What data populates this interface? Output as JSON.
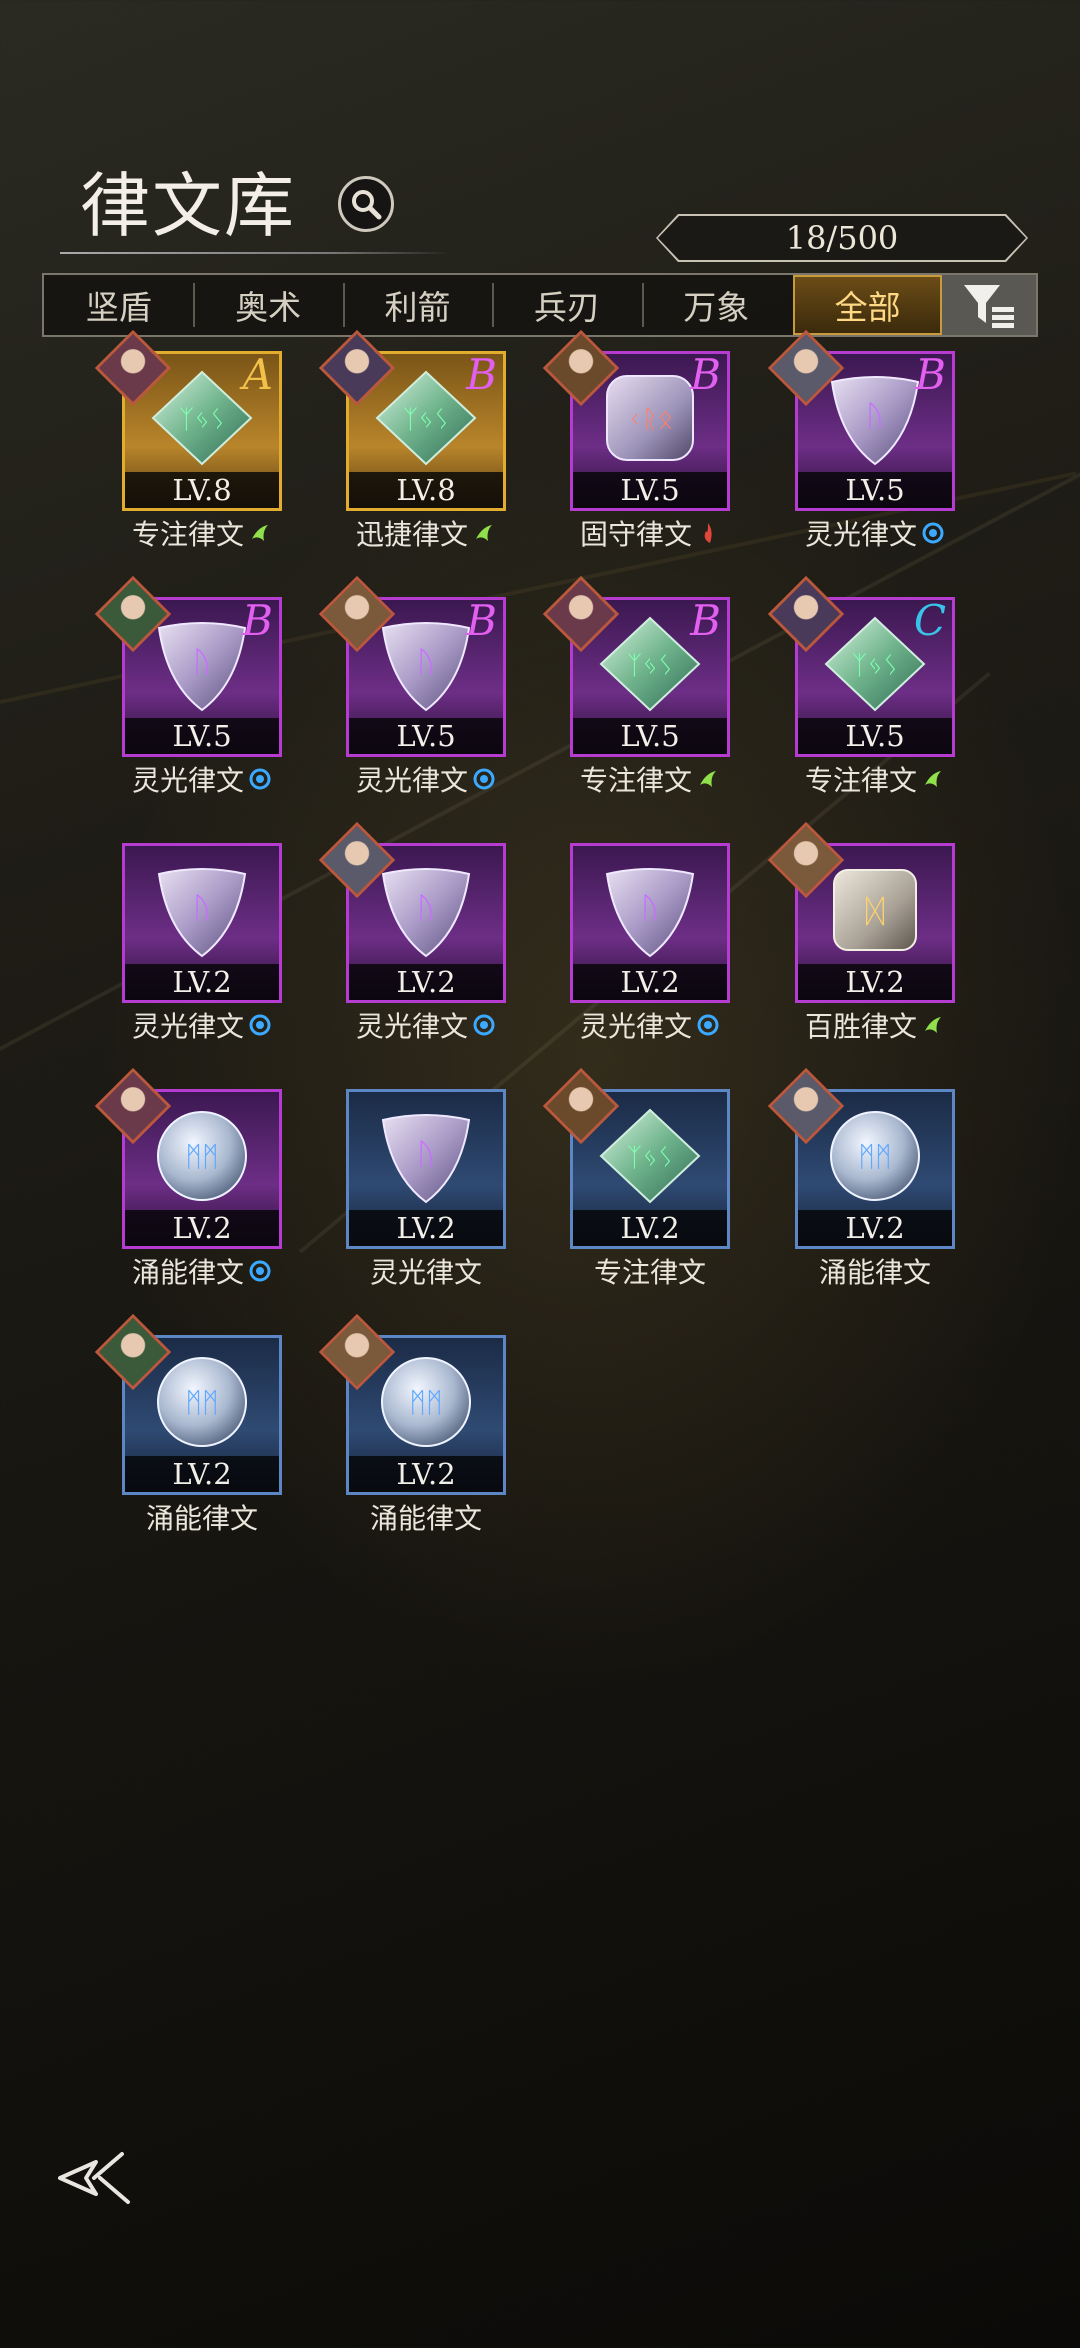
{
  "header": {
    "title": "律文库",
    "counter": "18/500"
  },
  "tabs": [
    {
      "label": "坚盾",
      "active": false
    },
    {
      "label": "奥术",
      "active": false
    },
    {
      "label": "利箭",
      "active": false
    },
    {
      "label": "兵刃",
      "active": false
    },
    {
      "label": "万象",
      "active": false
    },
    {
      "label": "全部",
      "active": true
    }
  ],
  "runes": [
    {
      "name": "专注律文",
      "level": "LV.8",
      "grade": "A",
      "rarity": "gold",
      "gem": "green-diamond",
      "element": "wind-icon",
      "avatar": true
    },
    {
      "name": "迅捷律文",
      "level": "LV.8",
      "grade": "B",
      "rarity": "gold",
      "gem": "green-diamond",
      "element": "wind-icon",
      "avatar": true
    },
    {
      "name": "固守律文",
      "level": "LV.5",
      "grade": "B",
      "rarity": "purple",
      "gem": "red-square",
      "element": "fire-icon",
      "avatar": true
    },
    {
      "name": "灵光律文",
      "level": "LV.5",
      "grade": "B",
      "rarity": "purple",
      "gem": "purple-triangle",
      "element": "water-icon",
      "avatar": true
    },
    {
      "name": "灵光律文",
      "level": "LV.5",
      "grade": "B",
      "rarity": "purple",
      "gem": "purple-triangle",
      "element": "water-icon",
      "avatar": true
    },
    {
      "name": "灵光律文",
      "level": "LV.5",
      "grade": "B",
      "rarity": "purple",
      "gem": "purple-triangle",
      "element": "water-icon",
      "avatar": true
    },
    {
      "name": "专注律文",
      "level": "LV.5",
      "grade": "B",
      "rarity": "purple",
      "gem": "green-diamond",
      "element": "wind-icon",
      "avatar": true
    },
    {
      "name": "专注律文",
      "level": "LV.5",
      "grade": "C",
      "rarity": "purple",
      "gem": "green-diamond",
      "element": "wind-icon",
      "avatar": true
    },
    {
      "name": "灵光律文",
      "level": "LV.2",
      "grade": "",
      "rarity": "purple",
      "gem": "purple-triangle",
      "element": "water-icon",
      "avatar": false
    },
    {
      "name": "灵光律文",
      "level": "LV.2",
      "grade": "",
      "rarity": "purple",
      "gem": "purple-triangle",
      "element": "water-icon",
      "avatar": true
    },
    {
      "name": "灵光律文",
      "level": "LV.2",
      "grade": "",
      "rarity": "purple",
      "gem": "purple-triangle",
      "element": "water-icon",
      "avatar": false
    },
    {
      "name": "百胜律文",
      "level": "LV.2",
      "grade": "",
      "rarity": "purple",
      "gem": "gold-square",
      "element": "wind-icon",
      "avatar": true
    },
    {
      "name": "涌能律文",
      "level": "LV.2",
      "grade": "",
      "rarity": "purple",
      "gem": "blue-round",
      "element": "water-icon",
      "avatar": true
    },
    {
      "name": "灵光律文",
      "level": "LV.2",
      "grade": "",
      "rarity": "blue",
      "gem": "purple-triangle",
      "element": "",
      "avatar": false
    },
    {
      "name": "专注律文",
      "level": "LV.2",
      "grade": "",
      "rarity": "blue",
      "gem": "green-diamond",
      "element": "",
      "avatar": true
    },
    {
      "name": "涌能律文",
      "level": "LV.2",
      "grade": "",
      "rarity": "blue",
      "gem": "blue-round",
      "element": "",
      "avatar": true
    },
    {
      "name": "涌能律文",
      "level": "LV.2",
      "grade": "",
      "rarity": "blue",
      "gem": "blue-round",
      "element": "",
      "avatar": true
    },
    {
      "name": "涌能律文",
      "level": "LV.2",
      "grade": "",
      "rarity": "blue",
      "gem": "blue-round",
      "element": "",
      "avatar": true
    }
  ],
  "colors": {
    "gold": "#e2ad2e",
    "purple": "#b53bd1",
    "blue": "#5d86c4",
    "active_tab": "#c79a3e"
  }
}
